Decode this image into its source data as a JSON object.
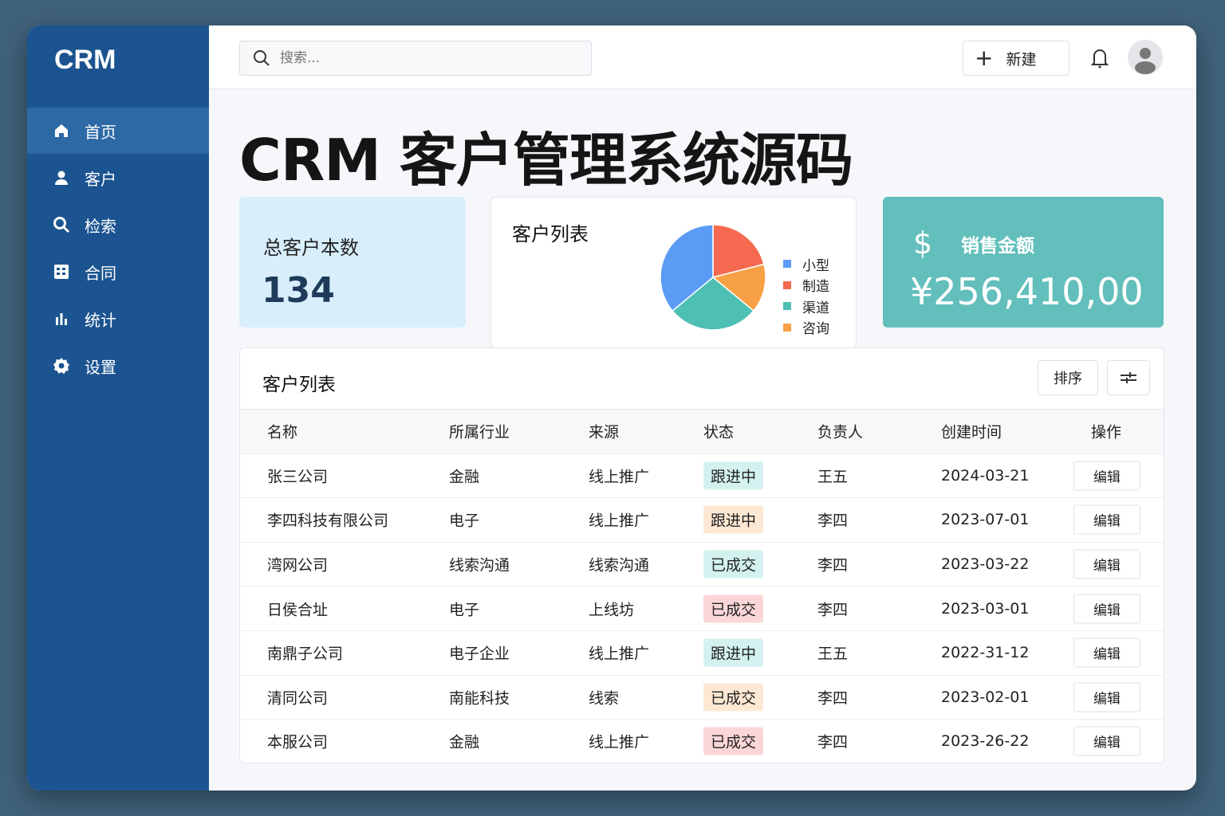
{
  "app": {
    "logo": "CRM"
  },
  "sidebar": {
    "items": [
      {
        "label": "首页",
        "icon": "home-icon"
      },
      {
        "label": "客户",
        "icon": "user-icon"
      },
      {
        "label": "检索",
        "icon": "search-icon"
      },
      {
        "label": "合同",
        "icon": "contract-icon"
      },
      {
        "label": "统计",
        "icon": "chart-icon"
      },
      {
        "label": "设置",
        "icon": "gear-icon"
      }
    ]
  },
  "header": {
    "search_placeholder": "搜索...",
    "new_label": "新建"
  },
  "page_title": "CRM 客户管理系统源码",
  "stats": {
    "customers_label": "总客户本数",
    "customers_value": "134",
    "chart_title": "客户列表",
    "amount_label": "销售金额",
    "amount_value": "¥256,410,00"
  },
  "chart_data": {
    "type": "pie",
    "title": "客户列表",
    "labels": [
      "小型",
      "制造",
      "渠道",
      "咨询"
    ],
    "values": [
      36,
      21,
      28,
      15
    ],
    "colors": [
      "#5b9bf5",
      "#f4694f",
      "#4dbfb3",
      "#f8a045"
    ]
  },
  "table": {
    "title": "客户列表",
    "sort_label": "排序",
    "columns": [
      "名称",
      "所属行业",
      "来源",
      "状态",
      "负责人",
      "创建时间",
      "操作"
    ],
    "rows": [
      {
        "name": "张三公司",
        "industry": "金融",
        "source": "线上推广",
        "status": "跟进中",
        "status_color": "teal",
        "owner": "王五",
        "date": "2024-03-21",
        "action": "编辑"
      },
      {
        "name": "李四科技有限公司",
        "industry": "电子",
        "source": "线上推广",
        "status": "跟进中",
        "status_color": "orange",
        "owner": "李四",
        "date": "2023-07-01",
        "action": "编辑"
      },
      {
        "name": "湾网公司",
        "industry": "线索沟通",
        "source": "线索沟通",
        "status": "已成交",
        "status_color": "teal",
        "owner": "李四",
        "date": "2023-03-22",
        "action": "编辑"
      },
      {
        "name": "日侯合址",
        "industry": "电子",
        "source": "上线坊",
        "status": "已成交",
        "status_color": "red",
        "owner": "李四",
        "date": "2023-03-01",
        "action": "编辑"
      },
      {
        "name": "南鼎子公司",
        "industry": "电子企业",
        "source": "线上推广",
        "status": "跟进中",
        "status_color": "teal",
        "owner": "王五",
        "date": "2022-31-12",
        "action": "编辑"
      },
      {
        "name": "清同公司",
        "industry": "南能科技",
        "source": "线索",
        "status": "已成交",
        "status_color": "orange",
        "owner": "李四",
        "date": "2023-02-01",
        "action": "编辑"
      },
      {
        "name": "本服公司",
        "industry": "金融",
        "source": "线上推广",
        "status": "已成交",
        "status_color": "red",
        "owner": "李四",
        "date": "2023-26-22",
        "action": "编辑"
      }
    ]
  }
}
